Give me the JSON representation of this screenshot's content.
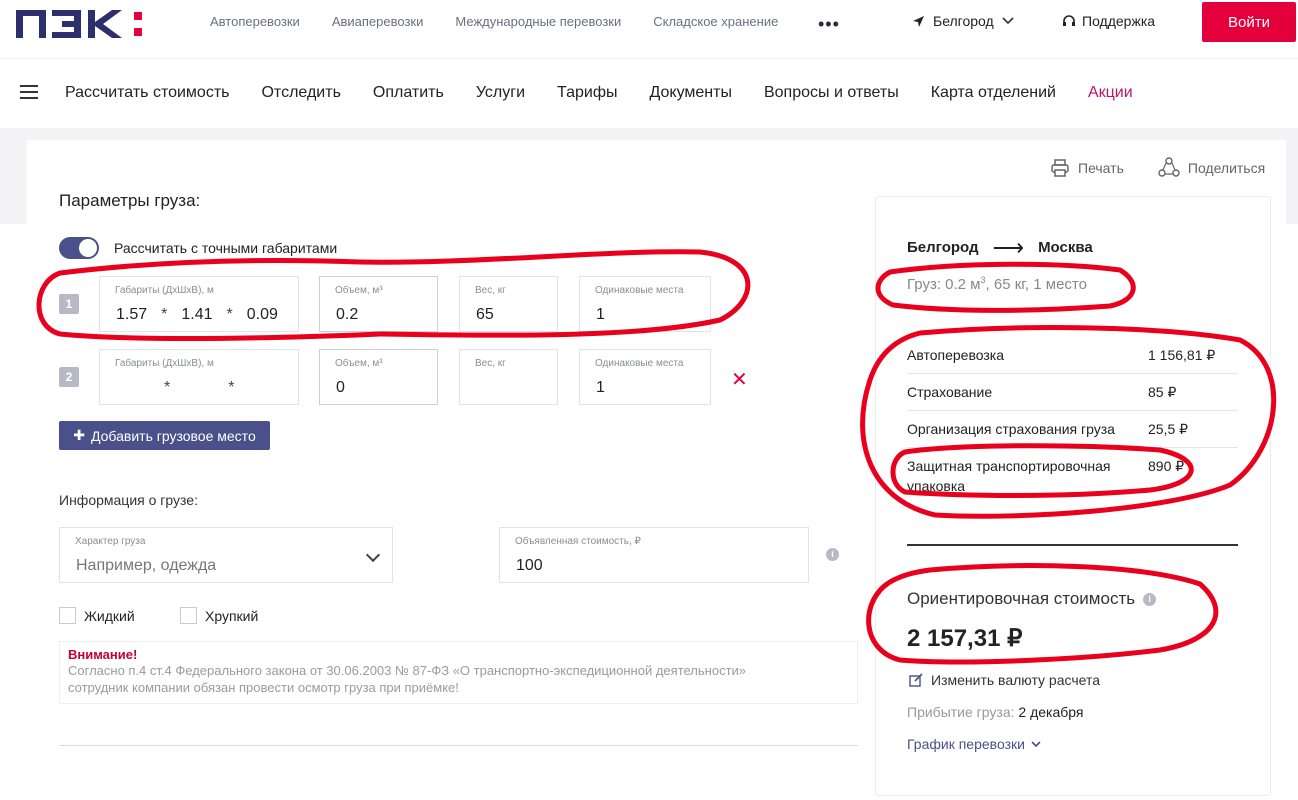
{
  "header": {
    "logo_text": "ПЭК:",
    "top_links": [
      "Автоперевозки",
      "Авиаперевозки",
      "Международные перевозки",
      "Складское хранение"
    ],
    "more": "•••",
    "city": "Белгород",
    "support": "Поддержка",
    "login": "Войти"
  },
  "nav": {
    "items": [
      "Рассчитать стоимость",
      "Отследить",
      "Оплатить",
      "Услуги",
      "Тарифы",
      "Документы",
      "Вопросы и ответы",
      "Карта отделений"
    ],
    "promo": "Акции"
  },
  "actions": {
    "print": "Печать",
    "share": "Поделиться"
  },
  "params": {
    "title": "Параметры груза:",
    "toggle_label": "Рассчитать с точными габаритами",
    "toggle_on": true,
    "labels": {
      "dims": "Габариты (ДхШхВ), м",
      "volume": "Объем, м³",
      "weight": "Вес, кг",
      "places": "Одинаковые места"
    },
    "rows": [
      {
        "num": "1",
        "l": "1.57",
        "w": "1.41",
        "h": "0.09",
        "volume": "0.2",
        "weight": "65",
        "places": "1"
      },
      {
        "num": "2",
        "l": "",
        "w": "",
        "h": "",
        "volume": "0",
        "weight": "",
        "places": "1"
      }
    ],
    "add_button": "Добавить грузовое место"
  },
  "cargo_info": {
    "title": "Информация о грузе:",
    "nature_label": "Характер груза",
    "nature_placeholder": "Например, одежда",
    "declared_label": "Объявленная стоимость, ₽",
    "declared_value": "100",
    "liquid": "Жидкий",
    "fragile": "Хрупкий"
  },
  "warning": {
    "title": "Внимание!",
    "line1": "Согласно п.4 ст.4 Федерального закона от 30.06.2003 № 87-ФЗ «О транспортно-экспедиционной деятельности»",
    "line2": "сотрудник компании обязан провести осмотр груза при приёмке!"
  },
  "summary": {
    "from": "Белгород",
    "to": "Москва",
    "cargo_prefix": "Груз: 0.2 м",
    "cargo_suffix": ", 65 кг, 1 место",
    "costs": [
      {
        "name": "Автоперевозка",
        "price": "1 156,81 ₽"
      },
      {
        "name": "Страхование",
        "price": "85 ₽"
      },
      {
        "name": "Организация страхования груза",
        "price": "25,5 ₽"
      },
      {
        "name": "Защитная транспортировочная упаковка",
        "price": "890 ₽"
      }
    ],
    "estimate_label": "Ориентировочная стоимость",
    "estimate_value": "2 157,31 ₽",
    "change_currency": "Изменить валюту расчета",
    "arrival_label": "Прибытие груза:",
    "arrival_date": "2 декабря",
    "schedule": "График перевозки"
  },
  "colors": {
    "brand_red": "#e4003a",
    "brand_navy": "#2b2f6b",
    "accent_purple": "#4a5089",
    "promo": "#b5176b",
    "annotation_red": "#e8001c"
  }
}
